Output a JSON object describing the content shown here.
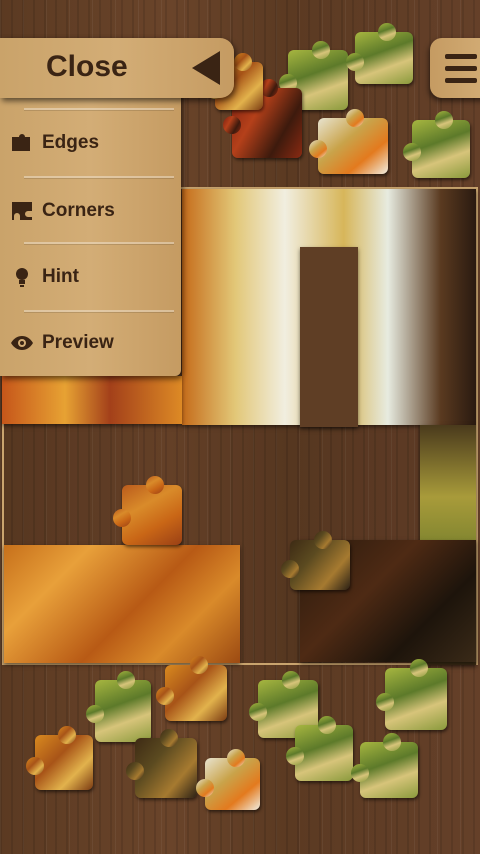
{
  "menu": {
    "close_label": "Close",
    "items": [
      {
        "label": "Edges",
        "icon": "puzzle-edge-icon"
      },
      {
        "label": "Corners",
        "icon": "puzzle-corner-icon"
      },
      {
        "label": "Hint",
        "icon": "lightbulb-icon"
      },
      {
        "label": "Preview",
        "icon": "eye-icon"
      }
    ]
  },
  "hamburger_icon": "menu-icon",
  "colors": {
    "wood_dark": "#5a3b22",
    "panel": "#d3ad76",
    "text": "#3a2414",
    "board_border": "#c9a46e"
  }
}
